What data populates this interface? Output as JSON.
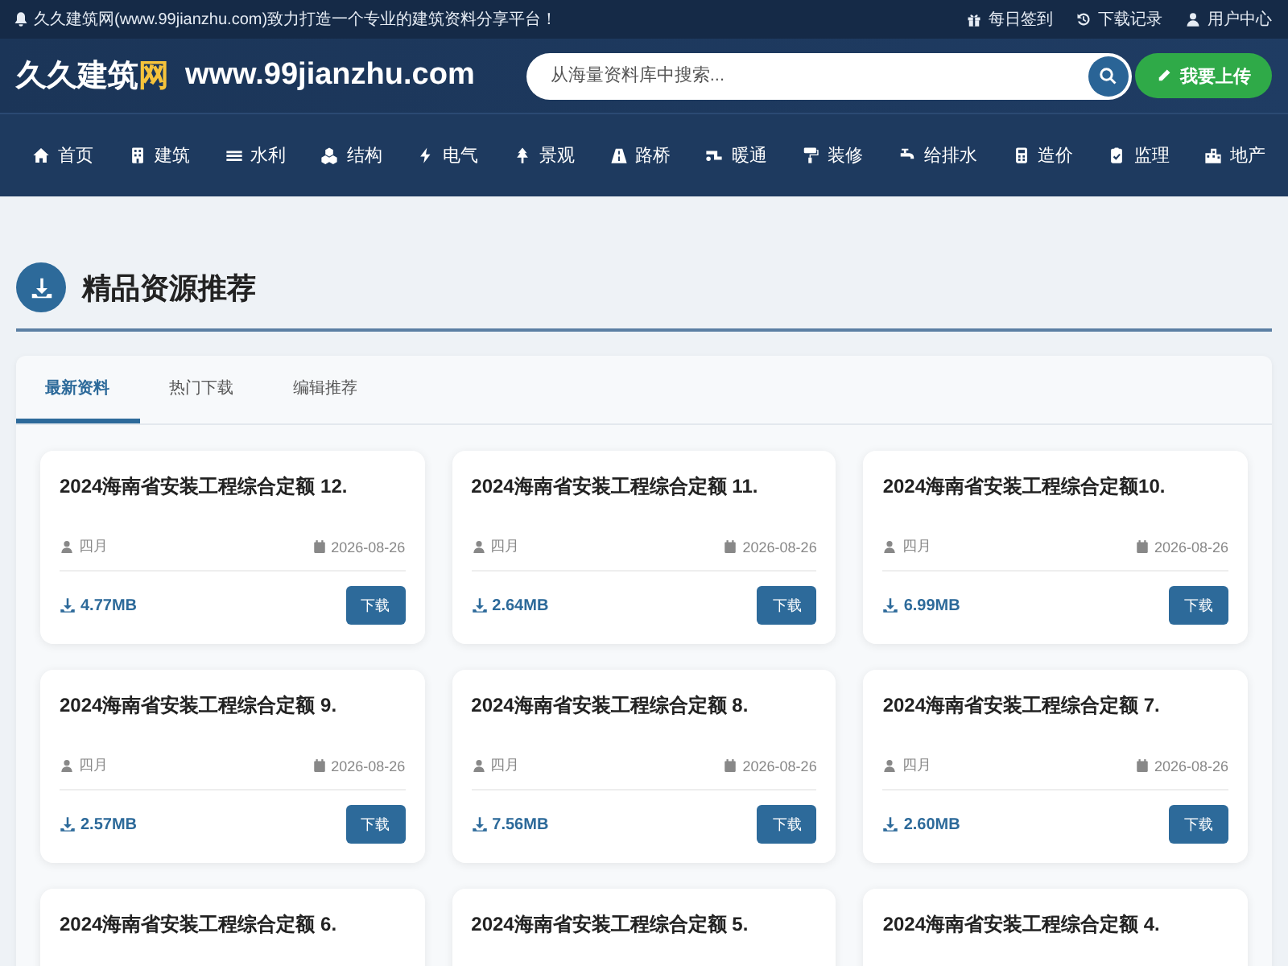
{
  "top_bar": {
    "slogan": "久久建筑网(www.99jianzhu.com)致力打造一个专业的建筑资料分享平台！",
    "links": [
      "每日签到",
      "下载记录",
      "用户中心"
    ]
  },
  "header": {
    "logo": "久久建筑",
    "logo_accent": "网",
    "domain": "www.99jianzhu.com",
    "search": {
      "placeholder": "从海量资料库中搜索..."
    },
    "upload_button": "我要上传"
  },
  "nav": [
    "首页",
    "建筑",
    "水利",
    "结构",
    "电气",
    "景观",
    "路桥",
    "暖通",
    "装修",
    "给排水",
    "造价",
    "监理",
    "地产"
  ],
  "section": {
    "title": "精品资源推荐"
  },
  "tabs": [
    {
      "label": "最新资料",
      "selected": true
    },
    {
      "label": "热门下载",
      "selected": false
    },
    {
      "label": "编辑推荐",
      "selected": false
    }
  ],
  "cards": [
    {
      "title": "2024海南省安装工程综合定额 12.",
      "author": "四月",
      "date": "2026-08-26",
      "size": "4.77MB",
      "button": "下载"
    },
    {
      "title": "2024海南省安装工程综合定额 11.",
      "author": "四月",
      "date": "2026-08-26",
      "size": "2.64MB",
      "button": "下载"
    },
    {
      "title": "2024海南省安装工程综合定额10.",
      "author": "四月",
      "date": "2026-08-26",
      "size": "6.99MB",
      "button": "下载"
    },
    {
      "title": "2024海南省安装工程综合定额 9.",
      "author": "四月",
      "date": "2026-08-26",
      "size": "2.57MB",
      "button": "下载"
    },
    {
      "title": "2024海南省安装工程综合定额 8.",
      "author": "四月",
      "date": "2026-08-26",
      "size": "7.56MB",
      "button": "下载"
    },
    {
      "title": "2024海南省安装工程综合定额 7.",
      "author": "四月",
      "date": "2026-08-26",
      "size": "2.60MB",
      "button": "下载"
    },
    {
      "title": "2024海南省安装工程综合定额 6."
    },
    {
      "title": "2024海南省安装工程综合定额 5."
    },
    {
      "title": "2024海南省安装工程综合定额 4."
    }
  ]
}
